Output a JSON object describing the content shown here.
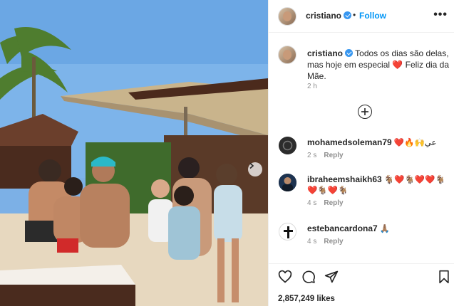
{
  "post": {
    "author": "cristiano",
    "follow_label": "Follow",
    "more_label": "•••",
    "caption": "Todos os dias são delas, mas hoje em especial ❤️ Feliz dia da Mãe.",
    "caption_time": "2 h",
    "likes": "2,857,249 likes"
  },
  "comments": [
    {
      "user": "mohamedsoleman79",
      "text": "❤️🔥🙌عي",
      "time": "2 s",
      "reply": "Reply"
    },
    {
      "user": "ibraheemshaikh63",
      "text": "🐐❤️🐐❤️❤️🐐❤️🐐❤️🐐",
      "time": "4 s",
      "reply": "Reply"
    },
    {
      "user": "estebancardona7",
      "text": "🙏🏽",
      "time": "4 s",
      "reply": "Reply"
    }
  ],
  "icons": {
    "like": "heart-icon",
    "comment": "comment-icon",
    "share": "share-icon",
    "save": "bookmark-icon",
    "add": "plus-circle-icon",
    "next": "chevron-right-icon",
    "verified": "verified-badge-icon"
  },
  "colors": {
    "follow": "#0095f6",
    "verified": "#3897f0",
    "meta": "#8e8e8e"
  }
}
